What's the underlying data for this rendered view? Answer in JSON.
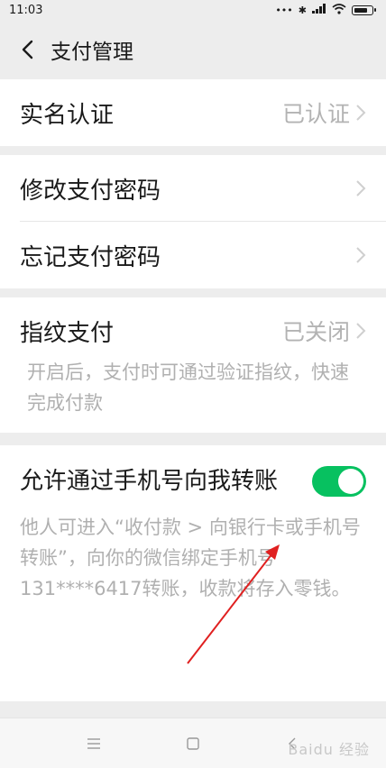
{
  "status_bar": {
    "time": "11:03",
    "icons": [
      "more-dots-icon",
      "bluetooth-icon",
      "signal-icon",
      "wifi-icon",
      "battery-icon"
    ]
  },
  "header": {
    "back_icon": "chevron-left-icon",
    "title": "支付管理"
  },
  "sections": {
    "verification": {
      "label": "实名认证",
      "value": "已认证"
    },
    "password": {
      "change_label": "修改支付密码",
      "forgot_label": "忘记支付密码"
    },
    "fingerprint": {
      "label": "指纹支付",
      "value": "已关闭",
      "description": "开启后，支付时可通过验证指纹，快速完成付款"
    },
    "phone_transfer": {
      "label": "允许通过手机号向我转账",
      "toggle_on": true,
      "description": "他人可进入“收付款 > 向银行卡或手机号转账”，向你的微信绑定手机号131****6417转账，收款将存入零钱。"
    }
  },
  "nav_bar": {
    "icons": [
      "menu-icon",
      "home-icon",
      "back-icon"
    ]
  },
  "watermark": "Baidu 经验",
  "colors": {
    "accent": "#07c160",
    "background": "#ededed",
    "annotation": "#e02020"
  }
}
